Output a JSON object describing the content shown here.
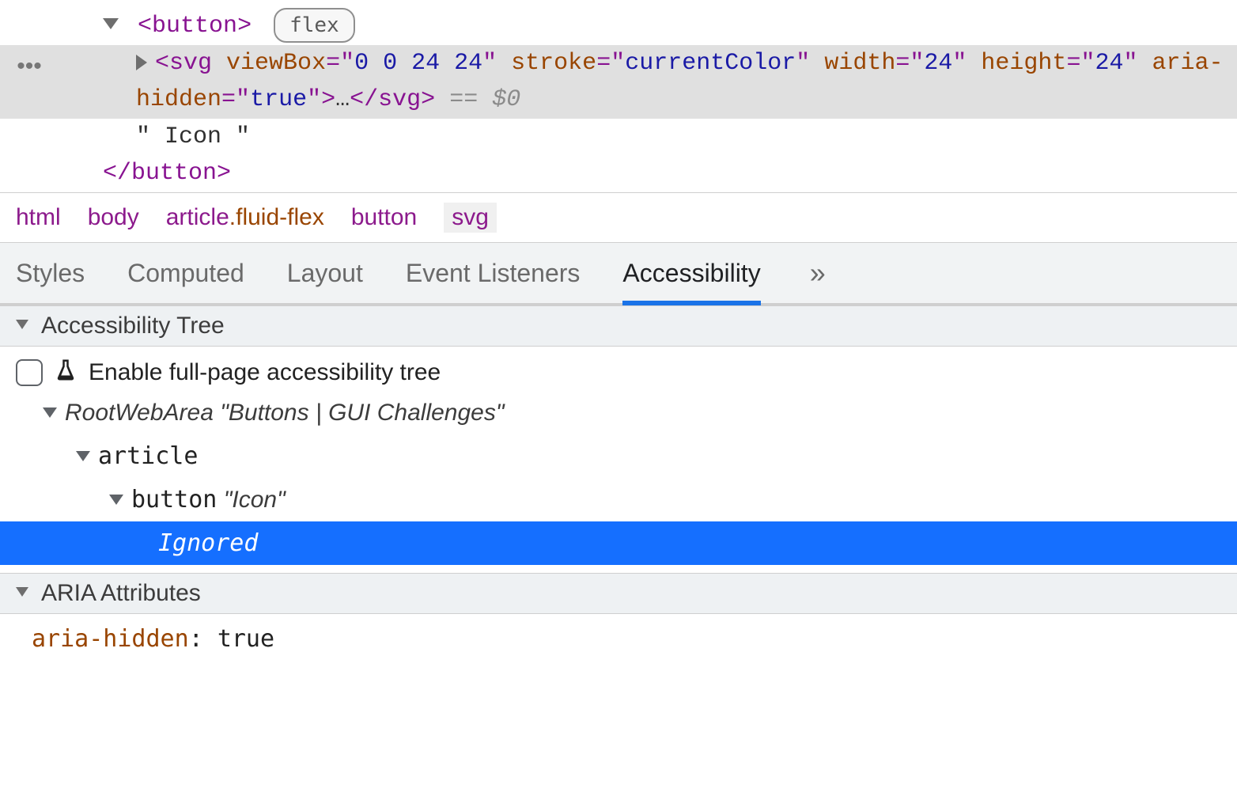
{
  "dom": {
    "button_open": "button",
    "flex_badge": "flex",
    "svg_tag": "svg",
    "svg_attrs": [
      {
        "name": "viewBox",
        "value": "0 0 24 24"
      },
      {
        "name": "stroke",
        "value": "currentColor"
      },
      {
        "name": "width",
        "value": "24"
      },
      {
        "name": "height",
        "value": "24"
      },
      {
        "name": "aria-hidden",
        "value": "true"
      }
    ],
    "svg_collapsed": "…",
    "ref": "== $0",
    "text_node": "\" Icon \"",
    "button_close": "button"
  },
  "breadcrumb": [
    "html",
    "body",
    "article.fluid-flex",
    "button",
    "svg"
  ],
  "tabs": {
    "items": [
      "Styles",
      "Computed",
      "Layout",
      "Event Listeners",
      "Accessibility"
    ],
    "active": "Accessibility",
    "more": "»"
  },
  "sections": {
    "a11y_tree_header": "Accessibility Tree",
    "aria_header": "ARIA Attributes"
  },
  "a11y": {
    "enable_label": "Enable full-page accessibility tree",
    "tree": {
      "root_role": "RootWebArea",
      "root_name": "\"Buttons | GUI Challenges\"",
      "article_role": "article",
      "button_role": "button",
      "button_name": "\"Icon\"",
      "ignored": "Ignored"
    }
  },
  "aria": {
    "key": "aria-hidden",
    "value": "true"
  }
}
